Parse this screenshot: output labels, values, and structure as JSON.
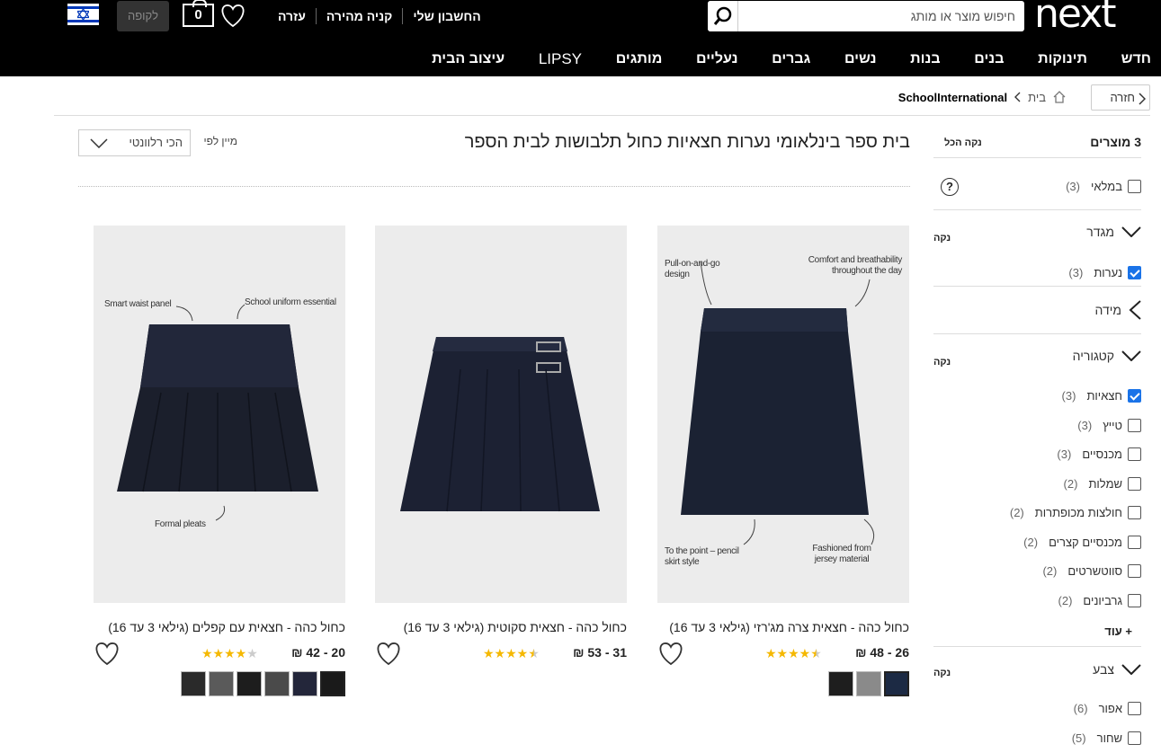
{
  "header": {
    "logo": "next",
    "search_placeholder": "חיפוש מוצר או מותג",
    "links": [
      "החשבון שלי",
      "קניה מהירה",
      "עזרה"
    ],
    "bag_count": "0",
    "checkout_label": "לקופה"
  },
  "nav": [
    "חדש",
    "תינוקות",
    "בנים",
    "בנות",
    "נשים",
    "גברים",
    "נעליים",
    "מותגים",
    "LIPSY",
    "עיצוב הבית"
  ],
  "breadcrumb": {
    "back_label": "חזרה",
    "home": "בית",
    "current": "SchoolInternational"
  },
  "main": {
    "title": "בית ספר בינלאומי נערות חצאיות כחול תלבושות לבית הספר",
    "sort_label": "מיין לפי",
    "sort_value": "הכי רלוונטי"
  },
  "sidebar": {
    "count_label": "3 מוצרים",
    "clear_all": "נקה הכל",
    "clear": "נקה",
    "in_stock": {
      "label": "במלאי",
      "count": "(3)"
    },
    "gender": {
      "title": "מגדר",
      "options": [
        {
          "label": "נערות",
          "count": "(3)",
          "checked": true
        }
      ]
    },
    "size": {
      "title": "מידה"
    },
    "category": {
      "title": "קטגוריה",
      "options": [
        {
          "label": "חצאיות",
          "count": "(3)",
          "checked": true
        },
        {
          "label": "טייץ",
          "count": "(3)",
          "checked": false
        },
        {
          "label": "מכנסיים",
          "count": "(3)",
          "checked": false
        },
        {
          "label": "שמלות",
          "count": "(2)",
          "checked": false
        },
        {
          "label": "חולצות מכופתרות",
          "count": "(2)",
          "checked": false
        },
        {
          "label": "מכנסיים קצרים",
          "count": "(2)",
          "checked": false
        },
        {
          "label": "סווטשרטים",
          "count": "(2)",
          "checked": false
        },
        {
          "label": "גרביונים",
          "count": "(2)",
          "checked": false
        }
      ],
      "more": "+ עוד"
    },
    "color": {
      "title": "צבע",
      "options": [
        {
          "label": "אפור",
          "count": "(6)",
          "checked": false
        },
        {
          "label": "שחור",
          "count": "(5)",
          "checked": false
        }
      ]
    }
  },
  "products": [
    {
      "name": "כחול כהה - חצאית צרה מג'רזי (גילאי 3 עד 16)",
      "price": "26 - 48 ₪",
      "rating": 4.5,
      "callouts": [
        "Pull-on-and-go design",
        "Comfort and breathability throughout the day",
        "To the point – pencil skirt style",
        "Fashioned from jersey material"
      ],
      "swatches": [
        "#1c2a44",
        "#8a8a8a",
        "#1e1e1e"
      ]
    },
    {
      "name": "כחול כהה - חצאית סקוטית (גילאי 3 עד 16)",
      "price": "31 - 53 ₪",
      "rating": 4.5,
      "callouts": [],
      "swatches": []
    },
    {
      "name": "כחול כהה - חצאית עם קפלים (גילאי 3 עד 16)",
      "price": "20 - 42 ₪",
      "rating": 4,
      "callouts": [
        "Smart waist panel",
        "School uniform essential",
        "Formal pleats"
      ],
      "swatches": [
        "#1a1a1a",
        "#23263a",
        "#4a4a4a",
        "#1d1d1d",
        "#5a5a5a",
        "#2a2a2a"
      ]
    }
  ],
  "colors": {
    "accent_checkbox": "#1a73e8",
    "star": "#f5b800"
  }
}
